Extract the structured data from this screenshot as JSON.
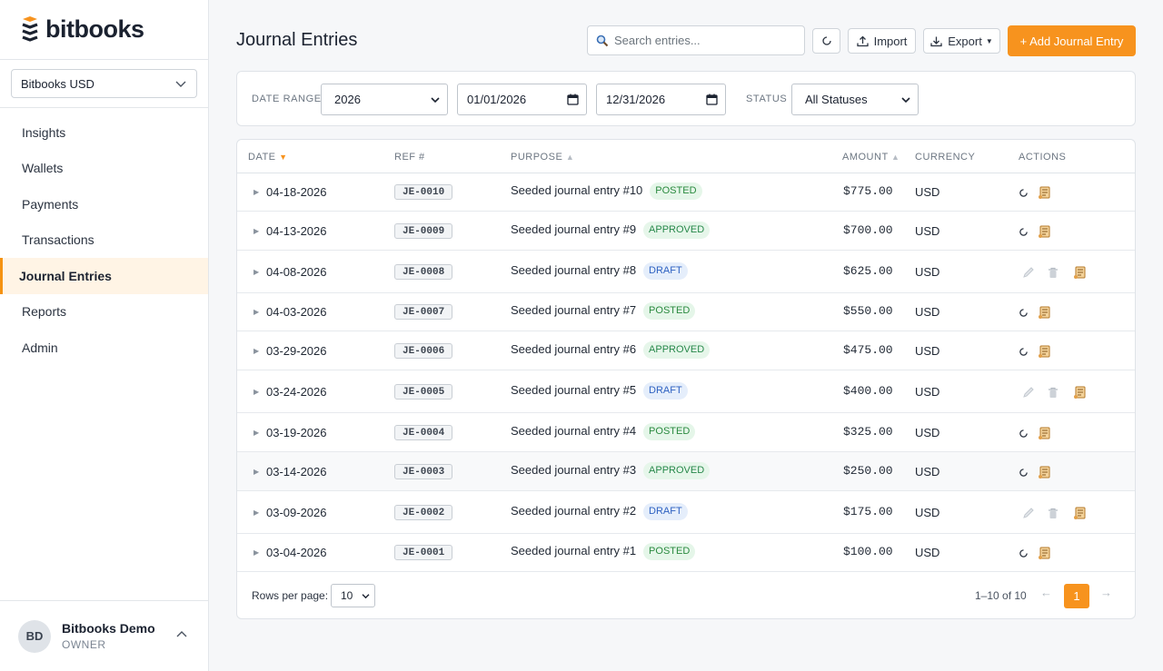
{
  "brand": {
    "name": "bitbooks",
    "accent": "#f7931e"
  },
  "org": {
    "selected": "Bitbooks USD"
  },
  "nav": {
    "items": [
      {
        "label": "Insights"
      },
      {
        "label": "Wallets"
      },
      {
        "label": "Payments"
      },
      {
        "label": "Transactions"
      },
      {
        "label": "Journal Entries",
        "active": true
      },
      {
        "label": "Reports"
      },
      {
        "label": "Admin"
      }
    ]
  },
  "user": {
    "initials": "BD",
    "name": "Bitbooks Demo",
    "role": "OWNER"
  },
  "header": {
    "title": "Journal Entries",
    "search_placeholder": "Search entries...",
    "import_label": "Import",
    "export_label": "Export",
    "add_label": "+ Add Journal Entry"
  },
  "filter": {
    "date_range_label": "DATE RANGE",
    "year": "2026",
    "start_date": "01/01/2026",
    "end_date": "12/31/2026",
    "status_label": "STATUS",
    "status_value": "All Statuses"
  },
  "table": {
    "columns": {
      "date": "DATE",
      "ref": "REF #",
      "purpose": "PURPOSE",
      "amount": "AMOUNT",
      "currency": "CURRENCY",
      "actions": "ACTIONS"
    },
    "rows": [
      {
        "date": "04-18-2026",
        "ref": "JE-0010",
        "purpose": "Seeded journal entry #10",
        "status": "POSTED",
        "amount": "$775.00",
        "currency": "USD"
      },
      {
        "date": "04-13-2026",
        "ref": "JE-0009",
        "purpose": "Seeded journal entry #9",
        "status": "APPROVED",
        "amount": "$700.00",
        "currency": "USD"
      },
      {
        "date": "04-08-2026",
        "ref": "JE-0008",
        "purpose": "Seeded journal entry #8",
        "status": "DRAFT",
        "amount": "$625.00",
        "currency": "USD"
      },
      {
        "date": "04-03-2026",
        "ref": "JE-0007",
        "purpose": "Seeded journal entry #7",
        "status": "POSTED",
        "amount": "$550.00",
        "currency": "USD"
      },
      {
        "date": "03-29-2026",
        "ref": "JE-0006",
        "purpose": "Seeded journal entry #6",
        "status": "APPROVED",
        "amount": "$475.00",
        "currency": "USD"
      },
      {
        "date": "03-24-2026",
        "ref": "JE-0005",
        "purpose": "Seeded journal entry #5",
        "status": "DRAFT",
        "amount": "$400.00",
        "currency": "USD"
      },
      {
        "date": "03-19-2026",
        "ref": "JE-0004",
        "purpose": "Seeded journal entry #4",
        "status": "POSTED",
        "amount": "$325.00",
        "currency": "USD"
      },
      {
        "date": "03-14-2026",
        "ref": "JE-0003",
        "purpose": "Seeded journal entry #3",
        "status": "APPROVED",
        "amount": "$250.00",
        "currency": "USD"
      },
      {
        "date": "03-09-2026",
        "ref": "JE-0002",
        "purpose": "Seeded journal entry #2",
        "status": "DRAFT",
        "amount": "$175.00",
        "currency": "USD"
      },
      {
        "date": "03-04-2026",
        "ref": "JE-0001",
        "purpose": "Seeded journal entry #1",
        "status": "POSTED",
        "amount": "$100.00",
        "currency": "USD"
      }
    ]
  },
  "pagination": {
    "rows_per_page_label": "Rows per page:",
    "rows_per_page": "10",
    "range": "1–10 of 10",
    "prev": "←",
    "current": "1",
    "next": "→"
  }
}
